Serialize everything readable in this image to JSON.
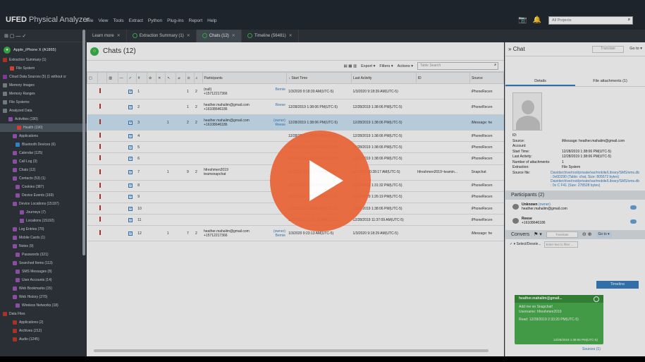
{
  "app": {
    "brand_bold": "UFED",
    "brand_rest": " Physical Analyzer",
    "menu": [
      "File",
      "View",
      "Tools",
      "Extract",
      "Python",
      "Plug-ins",
      "Report",
      "Help"
    ],
    "project_placeholder": "All Projects"
  },
  "sidebar": {
    "device": "Apple_iPhone X (A1865)",
    "items": [
      {
        "label": "Extraction Summary (1)",
        "color": "#c0392b",
        "indent": 4
      },
      {
        "label": "File System",
        "color": "#e74c3c",
        "indent": 14
      },
      {
        "label": "Cloud Data Sources (5) (1 without cr",
        "color": "#8e44ad",
        "indent": 4
      },
      {
        "label": "Memory Images",
        "color": "#7f8c8d",
        "indent": 4
      },
      {
        "label": "Memory Ranges",
        "color": "#7f8c8d",
        "indent": 4
      },
      {
        "label": "File Systems",
        "color": "#7f8c8d",
        "indent": 4
      },
      {
        "label": "Analyzed Data",
        "color": "#7f8c8d",
        "indent": 4
      },
      {
        "label": "Activities (190)",
        "color": "#9b59b6",
        "indent": 12
      },
      {
        "label": "Health (190)",
        "color": "#e74c3c",
        "indent": 24,
        "selected": true
      },
      {
        "label": "Applications",
        "color": "#9b59b6",
        "indent": 18
      },
      {
        "label": "Bluetooth Devices (6)",
        "color": "#3498db",
        "indent": 22
      },
      {
        "label": "Calendar (125)",
        "color": "#9b59b6",
        "indent": 18
      },
      {
        "label": "Call Log (3)",
        "color": "#9b59b6",
        "indent": 18
      },
      {
        "label": "Chats (12)",
        "color": "#9b59b6",
        "indent": 18
      },
      {
        "label": "Contacts (53) (1)",
        "color": "#9b59b6",
        "indent": 18
      },
      {
        "label": "Cookies (387)",
        "color": "#9b59b6",
        "indent": 22
      },
      {
        "label": "Device Events (169)",
        "color": "#9b59b6",
        "indent": 22
      },
      {
        "label": "Device Locations (15197)",
        "color": "#9b59b6",
        "indent": 18
      },
      {
        "label": "Journeys (7)",
        "color": "#9b59b6",
        "indent": 28
      },
      {
        "label": "Locations (15192)",
        "color": "#9b59b6",
        "indent": 28
      },
      {
        "label": "Log Entries (70)",
        "color": "#9b59b6",
        "indent": 18
      },
      {
        "label": "Mobile Cards (1)",
        "color": "#9b59b6",
        "indent": 18
      },
      {
        "label": "Notes (9)",
        "color": "#9b59b6",
        "indent": 18
      },
      {
        "label": "Passwords (321)",
        "color": "#9b59b6",
        "indent": 22
      },
      {
        "label": "Searched Items (113)",
        "color": "#9b59b6",
        "indent": 18
      },
      {
        "label": "SMS Messages (8)",
        "color": "#9b59b6",
        "indent": 22
      },
      {
        "label": "User Accounts (14)",
        "color": "#9b59b6",
        "indent": 22
      },
      {
        "label": "Web Bookmarks (15)",
        "color": "#9b59b6",
        "indent": 18
      },
      {
        "label": "Web History (270)",
        "color": "#9b59b6",
        "indent": 18
      },
      {
        "label": "Wireless Networks (18)",
        "color": "#9b59b6",
        "indent": 22
      },
      {
        "label": "Data Files",
        "color": "#c0392b",
        "indent": 4
      },
      {
        "label": "Applications (2)",
        "color": "#c0392b",
        "indent": 18
      },
      {
        "label": "Archives (212)",
        "color": "#c0392b",
        "indent": 18
      },
      {
        "label": "Audio (1245)",
        "color": "#c0392b",
        "indent": 18
      }
    ]
  },
  "tabs": [
    {
      "label": "Learn more",
      "active": false,
      "icon": false
    },
    {
      "label": "Extraction Summary (1)",
      "active": false,
      "icon": true
    },
    {
      "label": "Chats (12)",
      "active": true,
      "icon": true
    },
    {
      "label": "Timeline (56481)",
      "active": false,
      "icon": true
    }
  ],
  "main": {
    "title": "Chats (12)",
    "export_label": "Export",
    "filters_label": "Filters",
    "actions_label": "Actions",
    "search_placeholder": "Table Search",
    "headers": [
      "#",
      "Participants",
      "Start Time",
      "Last Activity",
      "ID",
      "Source"
    ],
    "rows": [
      {
        "n": "1",
        "a": "1",
        "b": "2",
        "p1": "(null)",
        "p2": "+15712217366",
        "extra": "Bernie",
        "start": "1/3/2020 9:18:39 AM(UTC-5)",
        "last": "1/3/2020 9:18:39 AM(UTC-5)",
        "id": "",
        "src": "iPhoneRecen",
        "tall": true
      },
      {
        "n": "2",
        "a": "1",
        "b": "2",
        "p1": "heather.mahalim@gmail.com",
        "p2": "+16108646186",
        "extra": "Reese",
        "start": "12/28/2019 1:38:06 PM(UTC-5)",
        "last": "12/28/2019 1:38:06 PM(UTC-5)",
        "id": "",
        "src": "iPhoneRecen",
        "tall": true
      },
      {
        "n": "3",
        "a": "2",
        "b": "2",
        "c": "1",
        "p1": "heather.mahalim@gmail.com",
        "p2": "+16108646186",
        "extra": "(owner)",
        "extra2": "Reese",
        "start": "12/28/2019 1:38:06 PM(UTC-5)",
        "last": "12/28/2019 1:38:06 PM(UTC-5)",
        "id": "",
        "src": "iMessage: he",
        "tall": true,
        "sel": true
      },
      {
        "n": "4",
        "start": "12/28/2019 1:38:06 PM(UTC-5)",
        "last": "12/28/2019 1:38:06 PM(UTC-5)",
        "src": "iPhoneRecen"
      },
      {
        "n": "5",
        "start": "12/28/2019 1:38:06 PM(UTC-5)",
        "last": "12/28/2019 1:38:06 PM(UTC-5)",
        "src": "iPhoneRecen"
      },
      {
        "n": "6",
        "start": "12/28/2019 1:38:06 PM(UTC-5)",
        "last": "12/28/2019 1:38:06 PM(UTC-5)",
        "src": "iPhoneRecen"
      },
      {
        "n": "7",
        "a": "9",
        "b": "2",
        "c": "1",
        "p1": "hfreshmen2019",
        "p2": "teamsnapchat",
        "start": "1/1/2020 10:28:17 AM(UTC-5)",
        "last": "1/1/2020 10:28:17 AM(UTC-5)",
        "id": "hfreshmen2019~teamin...",
        "src": "Snapchat",
        "tall": true
      },
      {
        "n": "8",
        "start": "12/28/2019 1:31:32 PM(UTC-5)",
        "last": "12/28/2019 1:31:32 PM(UTC-5)",
        "src": "iPhoneRecen"
      },
      {
        "n": "9",
        "start": "12/28/2019 1:26:19 PM(UTC-5)",
        "last": "12/28/2019 1:26:19 PM(UTC-5)",
        "src": "iPhoneRecen"
      },
      {
        "n": "10",
        "start": "12/28/2019 1:38:06 PM(UTC-5)",
        "last": "12/28/2019 1:38:06 PM(UTC-5)",
        "src": "iPhoneRecen"
      },
      {
        "n": "11",
        "start": "12/28/2019 11:37:09 AM(UTC-5)",
        "last": "12/28/2019 11:37:09 AM(UTC-5)",
        "src": "iPhoneRecen"
      },
      {
        "n": "12",
        "a": "7",
        "b": "2",
        "c": "1",
        "p1": "heather.mahalim@gmail.com",
        "p2": "+15712217366",
        "extra": "(owner)",
        "extra2": "Bernie",
        "start": "1/3/2020 9:23:13 AM(UTC-5)",
        "last": "1/3/2020 9:18:29 AM(UTC-5)",
        "id": "",
        "src": "iMessage: he",
        "tall": true
      }
    ]
  },
  "chat_panel": {
    "title": "Chat",
    "translate": "Translate",
    "goto": "Go to",
    "tab_details": "Details",
    "tab_attachments": "File attachments (1)",
    "props": [
      {
        "k": "ID:",
        "v": ""
      },
      {
        "k": "Source:",
        "v": "iMessage: heather.mahalim@gmail.com"
      },
      {
        "k": "Account:",
        "v": ""
      },
      {
        "k": "Start Time:",
        "v": "12/28/2019 1:38:06 PM(UTC-5)"
      },
      {
        "k": "Last Activity:",
        "v": "12/28/2019 1:38:06 PM(UTC-5)"
      },
      {
        "k": "Number of attachments:",
        "v": "1"
      },
      {
        "k": "Extraction:",
        "v": "File System"
      },
      {
        "k": "Source file:",
        "v": "Davidsrchive/root/private/var/mobile/Library/SMS/sms.db : 0x6D290 (Table: chat, Size: 805672 bytes) Davidsrchive/root/private/var/mobile/Library/SMS/sms.db : 0x C F41 (Size: 278528 bytes)",
        "link": true
      }
    ],
    "participants_title": "Participants (2)",
    "participants": [
      {
        "name": "Unknown",
        "tag": "(owner)",
        "id": "heather.mahalim@gmail.com"
      },
      {
        "name": "Reese",
        "tag": "",
        "id": "+16108646186"
      }
    ],
    "conv_title": "Convers",
    "conv_translate": "Translate",
    "conv_goto": "Go to",
    "timeline_option": "Timeline",
    "select_deselect": "Select/Desele...",
    "filter_placeholder": "Enter text to filter ...",
    "bubble_from": "heather.mahalim@gmail...",
    "bubble_line1": "Add me on Snapchat!",
    "bubble_line2": "Username: hfreshmen2019",
    "bubble_read": "Read: 12/28/2019 2:33:20 PM(UTC-5)",
    "bubble_time": "12/28/2019 1:38:06 PM(UTC-5)",
    "sources": "Sources (1)"
  }
}
